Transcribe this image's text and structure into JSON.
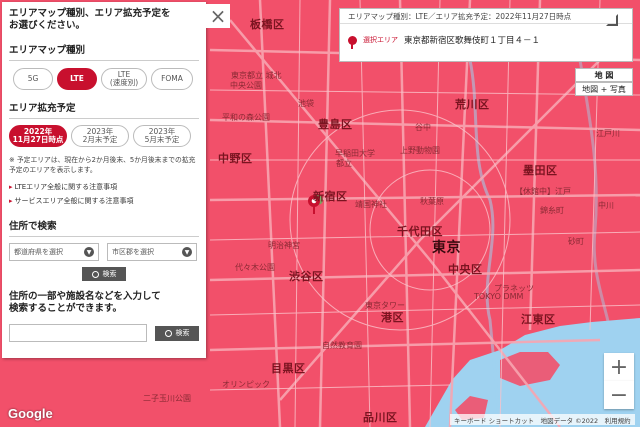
{
  "panel": {
    "intro": "エリアマップ種別、エリア拡充予定を\nお選びください。",
    "map_type_heading": "エリアマップ種別",
    "map_types": [
      {
        "label": "5G",
        "selected": false
      },
      {
        "label": "LTE",
        "selected": true
      },
      {
        "label": "LTE\n(速度別)",
        "selected": false
      },
      {
        "label": "FOMA",
        "selected": false
      }
    ],
    "expansion_heading": "エリア拡充予定",
    "expansion": [
      {
        "label": "2022年\n11月27日時点",
        "selected": true
      },
      {
        "label": "2023年\n2月末予定",
        "selected": false
      },
      {
        "label": "2023年\n5月末予定",
        "selected": false
      }
    ],
    "note": "※ 予定エリアは、現在から2か月後末、5か月後末までの拡充予定のエリアを表示します。",
    "links": [
      "LTEエリア全般に関する注意事項",
      "サービスエリア全般に関する注意事項"
    ],
    "address_heading": "住所で検索",
    "pref_select": "都道府県を選択",
    "city_select": "市区郡を選択",
    "search_label": "検索",
    "keyword_desc": "住所の一部や施設名などを入力して\n検索することができます。",
    "keyword_value": "",
    "keyword_search_label": "検索"
  },
  "close_icon": "×",
  "info": {
    "title": "エリアマップ種別：LTE／エリア拡充予定：2022年11月27日時点",
    "addr_label": "選択エリア",
    "address": "東京都新宿区歌舞伎町１丁目４－１"
  },
  "map_types_ctrl": {
    "map": "地 図",
    "map_photo": "地図 + 写真"
  },
  "zoom": {
    "in": "+",
    "out": "−"
  },
  "logo": "Google",
  "attribution": "キーボード ショートカット　地図データ ©2022　利用規約",
  "wards": [
    {
      "name": "板橋区"
    },
    {
      "name": "北区"
    },
    {
      "name": "荒川区"
    },
    {
      "name": "豊島区"
    },
    {
      "name": "墨田区"
    },
    {
      "name": "新宿区"
    },
    {
      "name": "千代田区"
    },
    {
      "name": "中野区"
    },
    {
      "name": "渋谷区"
    },
    {
      "name": "中央区"
    },
    {
      "name": "港区"
    },
    {
      "name": "江東区"
    },
    {
      "name": "目黒区"
    },
    {
      "name": "品川区"
    },
    {
      "name": "東京"
    }
  ],
  "places": [
    "東京都立 城北",
    "中央公園",
    "上野動物園",
    "早稲田大学",
    "都立",
    "靖国神社",
    "秋葉原",
    "明治神宮",
    "代々木公園",
    "東京タワー",
    "TOKYO DMM",
    "プラネッツ",
    "自然教育園",
    "オリンピック",
    "二子玉川公園",
    "砂町",
    "中川",
    "【休館中】江戸",
    "錦糸町",
    "江戸川",
    "平和の森公園",
    "池袋",
    "谷中"
  ],
  "colors": {
    "coverage": "#f2506a",
    "road": "#f8a5b0",
    "water": "#9fd2f0",
    "accent": "#c8102e"
  }
}
